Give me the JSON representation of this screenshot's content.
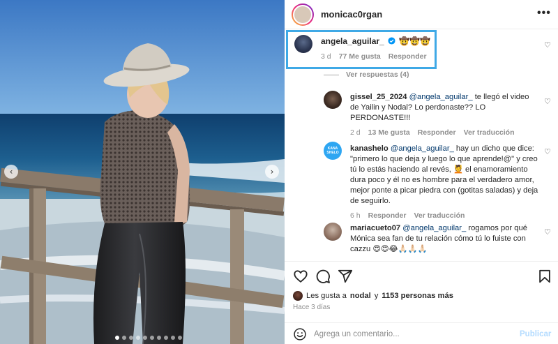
{
  "post": {
    "author": "monicac0rgan",
    "more_label": "•••",
    "carousel": {
      "active_index": 0,
      "count": 10,
      "prev_icon": "‹",
      "next_icon": "›"
    }
  },
  "comments": [
    {
      "user": "angela_aguilar_",
      "verified": true,
      "text": "🤠🤠🤠",
      "age": "3 d",
      "likes": "77 Me gusta",
      "reply": "Responder",
      "view_replies": "Ver respuestas (4)"
    },
    {
      "user": "gissel_25_2024",
      "mention": "@angela_aguilar_",
      "text": " te llegó el video de Yailin y Nodal? Lo perdonaste?? LO PERDONASTE!!!",
      "age": "2 d",
      "likes": "13 Me gusta",
      "reply": "Responder",
      "translate": "Ver traducción"
    },
    {
      "user": "kanashelo",
      "avatar_text": "KANA SHELO",
      "mention": "@angela_aguilar_",
      "text": " hay un dicho que dice: \"primero lo que deja y luego lo que aprende!@\" y creo tú lo estás haciendo al revés, 💆 el enamoramiento dura poco y él no es hombre para el verdadero amor, mejor ponte a picar piedra con (gotitas saladas) y deja de seguirlo.",
      "age": "6 h",
      "reply": "Responder",
      "translate": "Ver traducción"
    },
    {
      "user": "mariacueto07",
      "mention": "@angela_aguilar_",
      "text": " rogamos por qué Mónica sea fan de tu relación cómo tú lo fuiste con cazzu 😍😍😂🙏🏻🙏🏻🙏🏻"
    }
  ],
  "footer": {
    "likes_prefix": "Les gusta a",
    "likes_user": "nodal",
    "likes_joiner": "y",
    "likes_count": "1153 personas más",
    "time": "Hace 3 días",
    "comment_placeholder": "Agrega un comentario...",
    "post_label": "Publicar"
  },
  "colors": {
    "highlight_border": "#3fa9e6",
    "verified": "#0095f6",
    "mention": "#00376b",
    "post_disabled": "#b3dbff"
  },
  "icons": {
    "actions": [
      "heart-icon",
      "comment-icon",
      "share-icon",
      "bookmark-icon"
    ],
    "comment_like": "heart-outline-icon"
  }
}
